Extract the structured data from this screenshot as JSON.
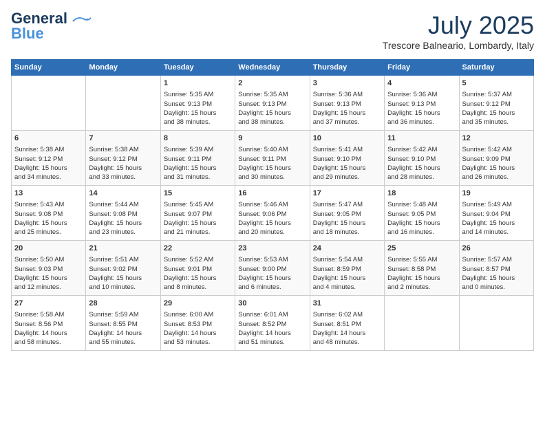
{
  "header": {
    "logo_line1": "General",
    "logo_line2": "Blue",
    "month_year": "July 2025",
    "location": "Trescore Balneario, Lombardy, Italy"
  },
  "days_of_week": [
    "Sunday",
    "Monday",
    "Tuesday",
    "Wednesday",
    "Thursday",
    "Friday",
    "Saturday"
  ],
  "weeks": [
    [
      {
        "day": "",
        "info": ""
      },
      {
        "day": "",
        "info": ""
      },
      {
        "day": "1",
        "info": "Sunrise: 5:35 AM\nSunset: 9:13 PM\nDaylight: 15 hours\nand 38 minutes."
      },
      {
        "day": "2",
        "info": "Sunrise: 5:35 AM\nSunset: 9:13 PM\nDaylight: 15 hours\nand 38 minutes."
      },
      {
        "day": "3",
        "info": "Sunrise: 5:36 AM\nSunset: 9:13 PM\nDaylight: 15 hours\nand 37 minutes."
      },
      {
        "day": "4",
        "info": "Sunrise: 5:36 AM\nSunset: 9:13 PM\nDaylight: 15 hours\nand 36 minutes."
      },
      {
        "day": "5",
        "info": "Sunrise: 5:37 AM\nSunset: 9:12 PM\nDaylight: 15 hours\nand 35 minutes."
      }
    ],
    [
      {
        "day": "6",
        "info": "Sunrise: 5:38 AM\nSunset: 9:12 PM\nDaylight: 15 hours\nand 34 minutes."
      },
      {
        "day": "7",
        "info": "Sunrise: 5:38 AM\nSunset: 9:12 PM\nDaylight: 15 hours\nand 33 minutes."
      },
      {
        "day": "8",
        "info": "Sunrise: 5:39 AM\nSunset: 9:11 PM\nDaylight: 15 hours\nand 31 minutes."
      },
      {
        "day": "9",
        "info": "Sunrise: 5:40 AM\nSunset: 9:11 PM\nDaylight: 15 hours\nand 30 minutes."
      },
      {
        "day": "10",
        "info": "Sunrise: 5:41 AM\nSunset: 9:10 PM\nDaylight: 15 hours\nand 29 minutes."
      },
      {
        "day": "11",
        "info": "Sunrise: 5:42 AM\nSunset: 9:10 PM\nDaylight: 15 hours\nand 28 minutes."
      },
      {
        "day": "12",
        "info": "Sunrise: 5:42 AM\nSunset: 9:09 PM\nDaylight: 15 hours\nand 26 minutes."
      }
    ],
    [
      {
        "day": "13",
        "info": "Sunrise: 5:43 AM\nSunset: 9:08 PM\nDaylight: 15 hours\nand 25 minutes."
      },
      {
        "day": "14",
        "info": "Sunrise: 5:44 AM\nSunset: 9:08 PM\nDaylight: 15 hours\nand 23 minutes."
      },
      {
        "day": "15",
        "info": "Sunrise: 5:45 AM\nSunset: 9:07 PM\nDaylight: 15 hours\nand 21 minutes."
      },
      {
        "day": "16",
        "info": "Sunrise: 5:46 AM\nSunset: 9:06 PM\nDaylight: 15 hours\nand 20 minutes."
      },
      {
        "day": "17",
        "info": "Sunrise: 5:47 AM\nSunset: 9:05 PM\nDaylight: 15 hours\nand 18 minutes."
      },
      {
        "day": "18",
        "info": "Sunrise: 5:48 AM\nSunset: 9:05 PM\nDaylight: 15 hours\nand 16 minutes."
      },
      {
        "day": "19",
        "info": "Sunrise: 5:49 AM\nSunset: 9:04 PM\nDaylight: 15 hours\nand 14 minutes."
      }
    ],
    [
      {
        "day": "20",
        "info": "Sunrise: 5:50 AM\nSunset: 9:03 PM\nDaylight: 15 hours\nand 12 minutes."
      },
      {
        "day": "21",
        "info": "Sunrise: 5:51 AM\nSunset: 9:02 PM\nDaylight: 15 hours\nand 10 minutes."
      },
      {
        "day": "22",
        "info": "Sunrise: 5:52 AM\nSunset: 9:01 PM\nDaylight: 15 hours\nand 8 minutes."
      },
      {
        "day": "23",
        "info": "Sunrise: 5:53 AM\nSunset: 9:00 PM\nDaylight: 15 hours\nand 6 minutes."
      },
      {
        "day": "24",
        "info": "Sunrise: 5:54 AM\nSunset: 8:59 PM\nDaylight: 15 hours\nand 4 minutes."
      },
      {
        "day": "25",
        "info": "Sunrise: 5:55 AM\nSunset: 8:58 PM\nDaylight: 15 hours\nand 2 minutes."
      },
      {
        "day": "26",
        "info": "Sunrise: 5:57 AM\nSunset: 8:57 PM\nDaylight: 15 hours\nand 0 minutes."
      }
    ],
    [
      {
        "day": "27",
        "info": "Sunrise: 5:58 AM\nSunset: 8:56 PM\nDaylight: 14 hours\nand 58 minutes."
      },
      {
        "day": "28",
        "info": "Sunrise: 5:59 AM\nSunset: 8:55 PM\nDaylight: 14 hours\nand 55 minutes."
      },
      {
        "day": "29",
        "info": "Sunrise: 6:00 AM\nSunset: 8:53 PM\nDaylight: 14 hours\nand 53 minutes."
      },
      {
        "day": "30",
        "info": "Sunrise: 6:01 AM\nSunset: 8:52 PM\nDaylight: 14 hours\nand 51 minutes."
      },
      {
        "day": "31",
        "info": "Sunrise: 6:02 AM\nSunset: 8:51 PM\nDaylight: 14 hours\nand 48 minutes."
      },
      {
        "day": "",
        "info": ""
      },
      {
        "day": "",
        "info": ""
      }
    ]
  ]
}
